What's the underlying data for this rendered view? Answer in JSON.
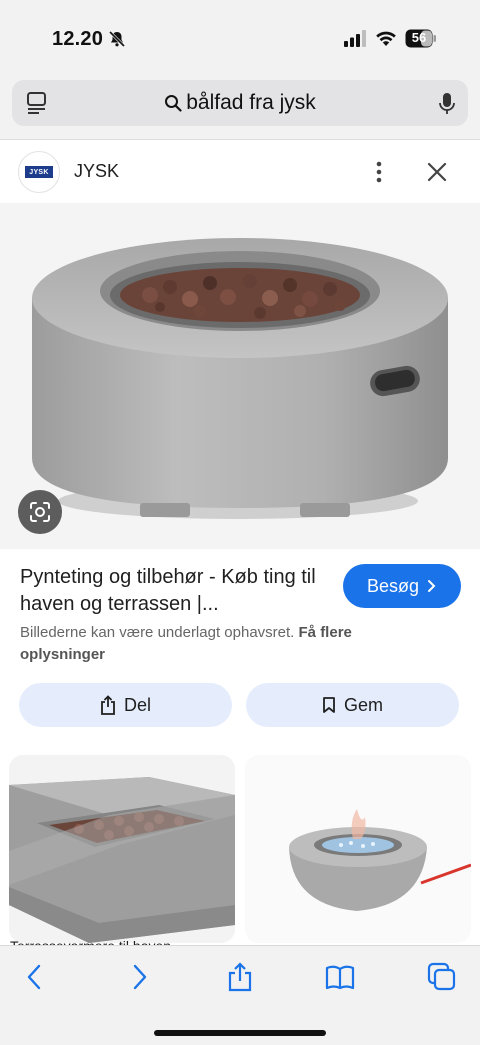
{
  "status_bar": {
    "time": "12.20",
    "battery": "56"
  },
  "search": {
    "query": "bålfad fra jysk"
  },
  "source": {
    "logo_text": "JYSK",
    "name": "JYSK"
  },
  "result": {
    "title": "Pynteting og tilbehør - Køb ting til haven og terrassen |...",
    "visit_label": "Besøg",
    "caption": "Billederne kan være underlagt ophavsret.",
    "caption_link": "Få flere oplysninger",
    "share_label": "Del",
    "save_label": "Gem"
  },
  "related": [
    {
      "label": "Terrassevarmere til haven"
    },
    {
      "label": ""
    }
  ],
  "colors": {
    "accent": "#1a73e8",
    "chip_bg": "#e5edfc",
    "toolbar_icon": "#1a73e8"
  },
  "icons": [
    "bell-slash-icon",
    "signal-icon",
    "wifi-icon",
    "battery-icon",
    "tabs-icon",
    "search-icon",
    "mic-icon",
    "more-icon",
    "close-icon",
    "lens-icon",
    "chevron-right-icon",
    "share-icon",
    "bookmark-icon",
    "back-icon",
    "forward-icon",
    "share-sheet-icon",
    "bookmarks-icon",
    "tabs-overview-icon"
  ]
}
